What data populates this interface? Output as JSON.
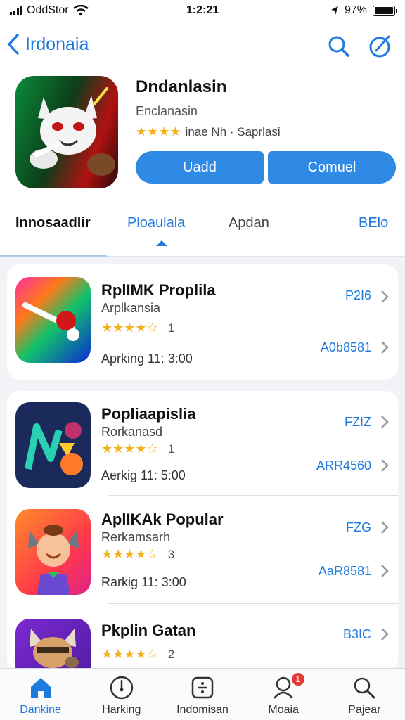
{
  "status": {
    "carrier": "OddStor",
    "time": "1:2:21",
    "battery": "97%",
    "battery_level": 0.97
  },
  "nav": {
    "back_label": "Irdonaia"
  },
  "hero": {
    "title": "Dndanlasin",
    "subtitle": "Enclanasin",
    "rating_text": "inae Nh · Saprlasi",
    "stars": 4,
    "btn_primary": "Uadd",
    "btn_secondary": "Comuel"
  },
  "tabs": [
    {
      "label": "Innosaadlir"
    },
    {
      "label": "Ploaulala"
    },
    {
      "label": "Apdan"
    },
    {
      "label": "BElo"
    }
  ],
  "apps": [
    {
      "name": "RplIMK Proplila",
      "category": "Arplkansia",
      "stars": 4.5,
      "rating_count": "1",
      "rank": "Aprking 11: 3:00",
      "price": "P2I6",
      "code": "A0b8581"
    },
    {
      "name": "Popliaapislia",
      "category": "Rorkanasd",
      "stars": 4.5,
      "rating_count": "1",
      "rank": "Aerkig 11: 5:00",
      "price": "FZIZ",
      "code": "ARR4560"
    },
    {
      "name": "AplIKAk Popular",
      "category": "Rerkamsarh",
      "stars": 4.5,
      "rating_count": "3",
      "rank": "Rarkig 11: 3:00",
      "price": "FZG",
      "code": "AaR8581"
    },
    {
      "name": "Pkplin Gatan",
      "category": "",
      "stars": 4.5,
      "rating_count": "2",
      "rank": "",
      "price": "B3IC",
      "code": ""
    }
  ],
  "tabbar": [
    {
      "label": "Dankine",
      "icon": "home-icon",
      "active": true
    },
    {
      "label": "Harking",
      "icon": "compass-icon",
      "active": false
    },
    {
      "label": "Indomisan",
      "icon": "divide-icon",
      "active": false
    },
    {
      "label": "Moaia",
      "icon": "person-icon",
      "badge": "1",
      "active": false
    },
    {
      "label": "Pajear",
      "icon": "search-icon",
      "active": false
    }
  ],
  "colors": {
    "accent": "#1f7ae0",
    "button": "#2f8ae6",
    "star": "#f3b21b",
    "badge": "#e53935"
  }
}
